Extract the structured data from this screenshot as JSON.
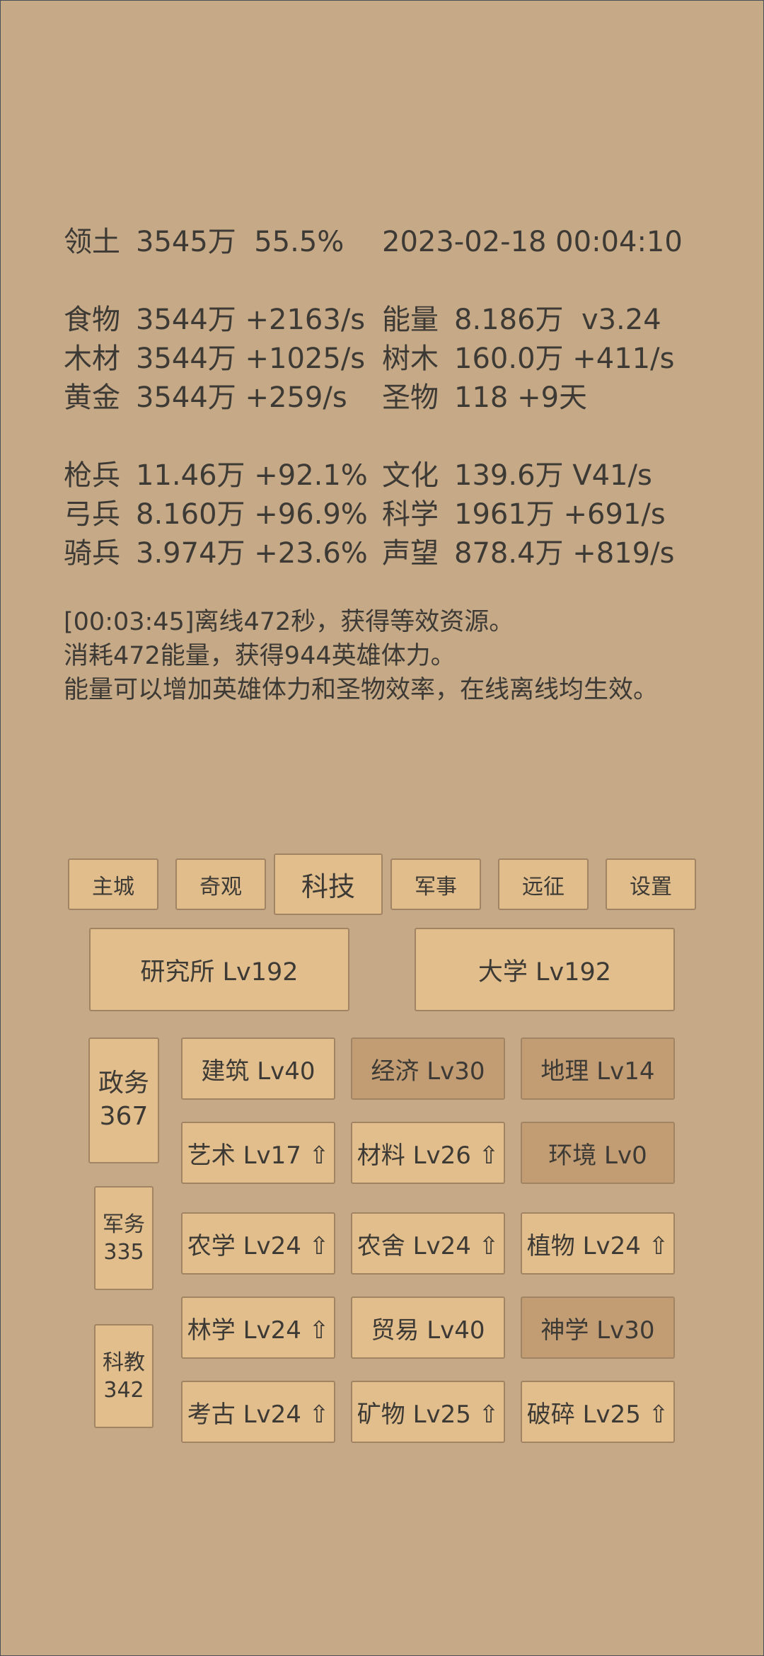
{
  "header": {
    "territory_label": "领土",
    "territory_value": "3545万",
    "territory_pct": "55.5%",
    "datetime": "2023-02-18 00:04:10"
  },
  "resources_left": [
    {
      "label": "食物",
      "value": "3544万 +2163/s"
    },
    {
      "label": "木材",
      "value": "3544万 +1025/s"
    },
    {
      "label": "黄金",
      "value": "3544万 +259/s"
    }
  ],
  "resources_right": [
    {
      "label": "能量",
      "value": "8.186万  v3.24"
    },
    {
      "label": "树木",
      "value": "160.0万 +411/s"
    },
    {
      "label": "圣物",
      "value": "118 +9天"
    }
  ],
  "army_left": [
    {
      "label": "枪兵",
      "value": "11.46万 +92.1%"
    },
    {
      "label": "弓兵",
      "value": "8.160万 +96.9%"
    },
    {
      "label": "骑兵",
      "value": "3.974万 +23.6%"
    }
  ],
  "army_right": [
    {
      "label": "文化",
      "value": "139.6万 V41/s"
    },
    {
      "label": "科学",
      "value": "1961万 +691/s"
    },
    {
      "label": "声望",
      "value": "878.4万 +819/s"
    }
  ],
  "log": [
    "[00:03:45]离线472秒，获得等效资源。",
    "消耗472能量，获得944英雄体力。",
    "能量可以增加英雄体力和圣物效率，在线离线均生效。"
  ],
  "tabs": [
    "主城",
    "奇观",
    "科技",
    "军事",
    "远征",
    "设置"
  ],
  "active_tab": "科技",
  "buildings": [
    "研究所 Lv192",
    "大学 Lv192"
  ],
  "side": [
    {
      "name": "政务",
      "value": "367"
    },
    {
      "name": "军务",
      "value": "335"
    },
    {
      "name": "科教",
      "value": "342"
    }
  ],
  "techs": [
    [
      "建筑 Lv40",
      "经济 Lv30",
      "地理 Lv14"
    ],
    [
      "艺术 Lv17 ⇧",
      "材料 Lv26 ⇧",
      "环境 Lv0"
    ],
    [
      "农学 Lv24 ⇧",
      "农舍 Lv24 ⇧",
      "植物 Lv24 ⇧"
    ],
    [
      "林学 Lv24 ⇧",
      "贸易 Lv40",
      "神学 Lv30"
    ],
    [
      "考古 Lv24 ⇧",
      "矿物 Lv25 ⇧",
      "破碎 Lv25 ⇧"
    ]
  ],
  "colors": {
    "background": "#c6a986",
    "button": "#e2be8c",
    "button_dark": "#c29d73",
    "text": "#3d3a35"
  }
}
